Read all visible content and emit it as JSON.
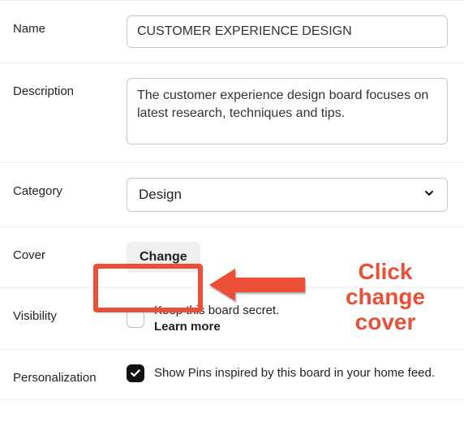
{
  "name": {
    "label": "Name",
    "value": "CUSTOMER EXPERIENCE DESIGN"
  },
  "description": {
    "label": "Description",
    "value": "The customer experience design board focuses on latest research, techniques and tips."
  },
  "category": {
    "label": "Category",
    "selected": "Design"
  },
  "cover": {
    "label": "Cover",
    "button": "Change"
  },
  "visibility": {
    "label": "Visibility",
    "checked": false,
    "text": "Keep this board secret.",
    "learn_more": "Learn more"
  },
  "personalization": {
    "label": "Personalization",
    "checked": true,
    "text": "Show Pins inspired by this board in your home feed."
  },
  "annotation": {
    "text": "Click change cover",
    "color": "#eb4f35"
  }
}
